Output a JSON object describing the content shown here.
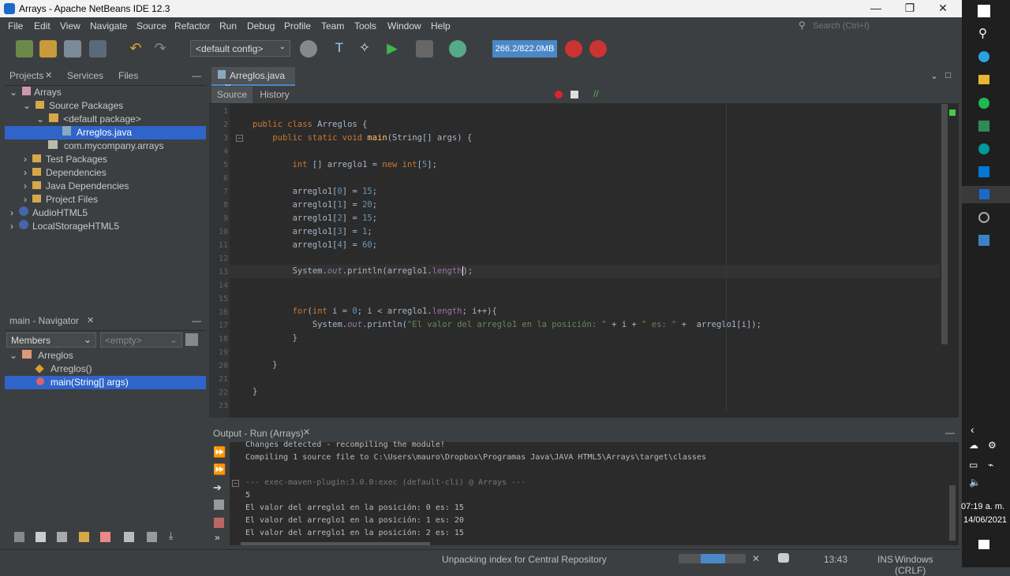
{
  "window": {
    "title": "Arrays - Apache NetBeans IDE 12.3"
  },
  "menu": [
    "File",
    "Edit",
    "View",
    "Navigate",
    "Source",
    "Refactor",
    "Run",
    "Debug",
    "Profile",
    "Team",
    "Tools",
    "Window",
    "Help"
  ],
  "search": {
    "placeholder": "Search (Ctrl+I)"
  },
  "toolbar": {
    "config": "<default config>",
    "memory": "266.2/822.0MB"
  },
  "projects": {
    "tabs": [
      "Projects",
      "Services",
      "Files"
    ],
    "tree": [
      {
        "label": "Arrays",
        "icon": "project-icon"
      },
      {
        "label": "Source Packages",
        "icon": "folder-icon"
      },
      {
        "label": "<default package>",
        "icon": "package-icon"
      },
      {
        "label": "Arreglos.java",
        "icon": "java-file-icon"
      },
      {
        "label": "com.mycompany.arrays",
        "icon": "package-icon"
      },
      {
        "label": "Test Packages",
        "icon": "folder-icon"
      },
      {
        "label": "Dependencies",
        "icon": "folder-icon"
      },
      {
        "label": "Java Dependencies",
        "icon": "folder-icon"
      },
      {
        "label": "Project Files",
        "icon": "folder-icon"
      },
      {
        "label": "AudioHTML5",
        "icon": "html5-project-icon"
      },
      {
        "label": "LocalStorageHTML5",
        "icon": "html5-project-icon"
      }
    ]
  },
  "navigator": {
    "title": "main - Navigator",
    "filter": "Members",
    "empty": "<empty>",
    "tree": [
      {
        "label": "Arreglos"
      },
      {
        "label": "Arreglos()"
      },
      {
        "label": "main(String[] args)"
      }
    ]
  },
  "editor": {
    "tab": "Arreglos.java",
    "source": "Source",
    "history": "History",
    "lines": [
      "1",
      "2",
      "3",
      "4",
      "5",
      "6",
      "7",
      "8",
      "9",
      "10",
      "11",
      "12",
      "13",
      "14",
      "15",
      "16",
      "17",
      "18",
      "19",
      "20",
      "21",
      "22",
      "23"
    ]
  },
  "output": {
    "title": "Output - Run (Arrays)",
    "lines": [
      "Changes detected - recompiling the module!",
      "Compiling 1 source file to C:\\Users\\mauro\\Dropbox\\Programas Java\\JAVA HTML5\\Arrays\\target\\classes",
      "--- exec-maven-plugin:3.0.0:exec (default-cli) @ Arrays ---",
      "5",
      "El valor del arreglo1 en la posición: 0 es: 15",
      "El valor del arreglo1 en la posición: 1 es: 20",
      "El valor del arreglo1 en la posición: 2 es: 15"
    ]
  },
  "status": {
    "message": "Unpacking index for Central Repository",
    "position": "13:43",
    "mode": "INS",
    "line_endings": "Windows (CRLF)"
  },
  "taskbar": {
    "time": "07:19 a. m.",
    "date": "14/06/2021"
  },
  "colors": {
    "accent": "#2f65ca",
    "memory": "#4a88c7"
  }
}
